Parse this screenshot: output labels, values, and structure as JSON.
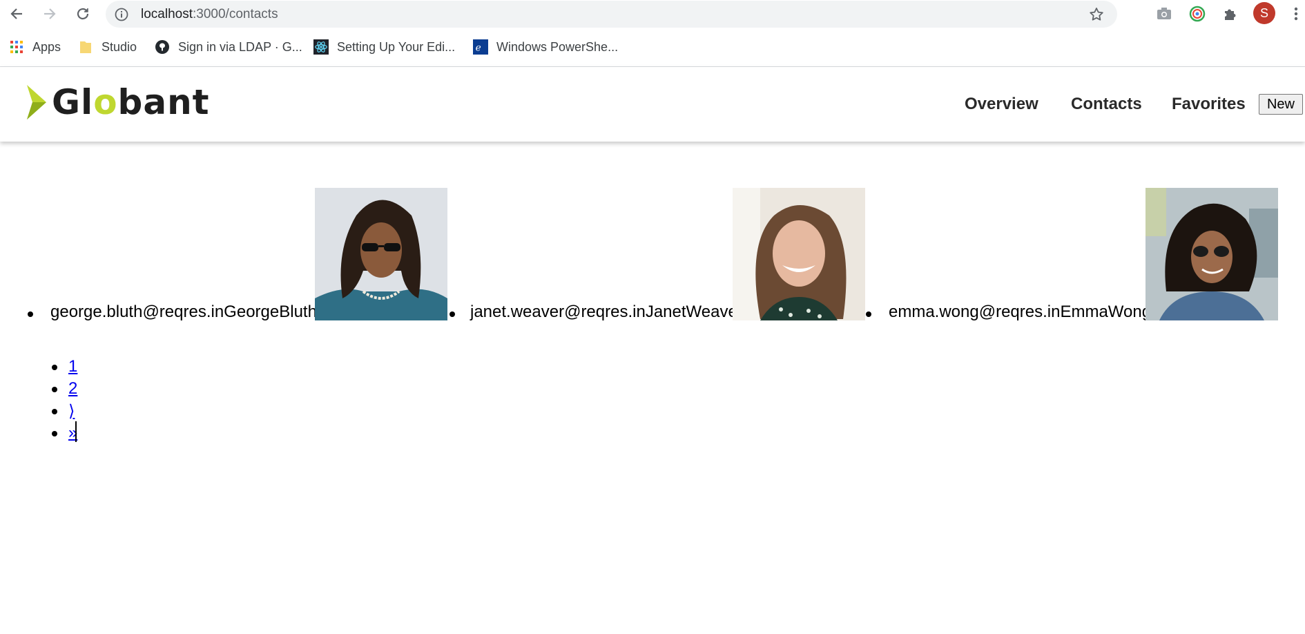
{
  "browser": {
    "url_host": "localhost",
    "url_path": ":3000/contacts",
    "profile_initial": "S",
    "bookmarks": [
      {
        "label": "Apps",
        "icon": "apps-grid-icon"
      },
      {
        "label": "Studio",
        "icon": "folder-icon"
      },
      {
        "label": "Sign in via LDAP · G...",
        "icon": "github-icon"
      },
      {
        "label": "Setting Up Your Edi...",
        "icon": "react-icon"
      },
      {
        "label": "Windows PowerShe...",
        "icon": "powershell-icon"
      }
    ]
  },
  "header": {
    "logo": "Globant",
    "nav": [
      "Overview",
      "Contacts",
      "Favorites"
    ],
    "new_button": "New",
    "brand_color": "#bfd730"
  },
  "contacts": [
    {
      "text": "george.bluth@reqres.inGeorgeBluth",
      "photo": "george-photo"
    },
    {
      "text": "janet.weaver@reqres.inJanetWeaver",
      "photo": "janet-photo"
    },
    {
      "text": "emma.wong@reqres.inEmmaWong",
      "photo": "emma-photo"
    }
  ],
  "pagination": [
    "1",
    "2",
    "⟩",
    "»"
  ]
}
